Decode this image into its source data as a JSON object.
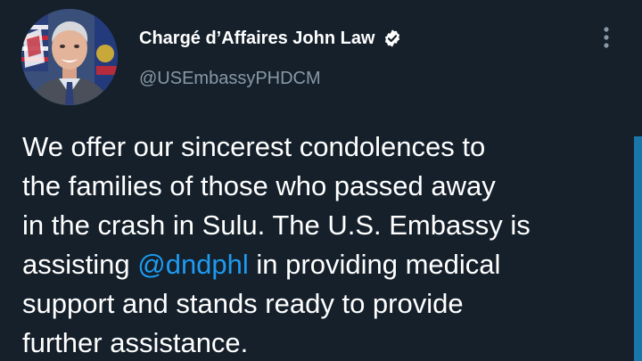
{
  "author": {
    "display_name": "Chargé d’Affaires John Law",
    "handle": "@USEmbassyPHDCM",
    "verified_icon": "verified-badge-icon"
  },
  "menu": {
    "icon": "more-vertical-icon"
  },
  "tweet": {
    "lines": [
      {
        "text": "We offer our sincerest condolences to"
      },
      {
        "text": "the families of those who passed away"
      },
      {
        "text": "in the crash in Sulu. The U.S. Embassy is"
      },
      {
        "before": "assisting ",
        "mention": "@dndphl",
        "after": " in providing medical"
      },
      {
        "text": "support and stands ready to provide"
      },
      {
        "text": "further assistance."
      }
    ]
  },
  "colors": {
    "background": "#15202b",
    "text": "#ffffff",
    "secondary_text": "#8899a6",
    "mention": "#1d9bf0",
    "scrollbar": "#1877a8"
  }
}
